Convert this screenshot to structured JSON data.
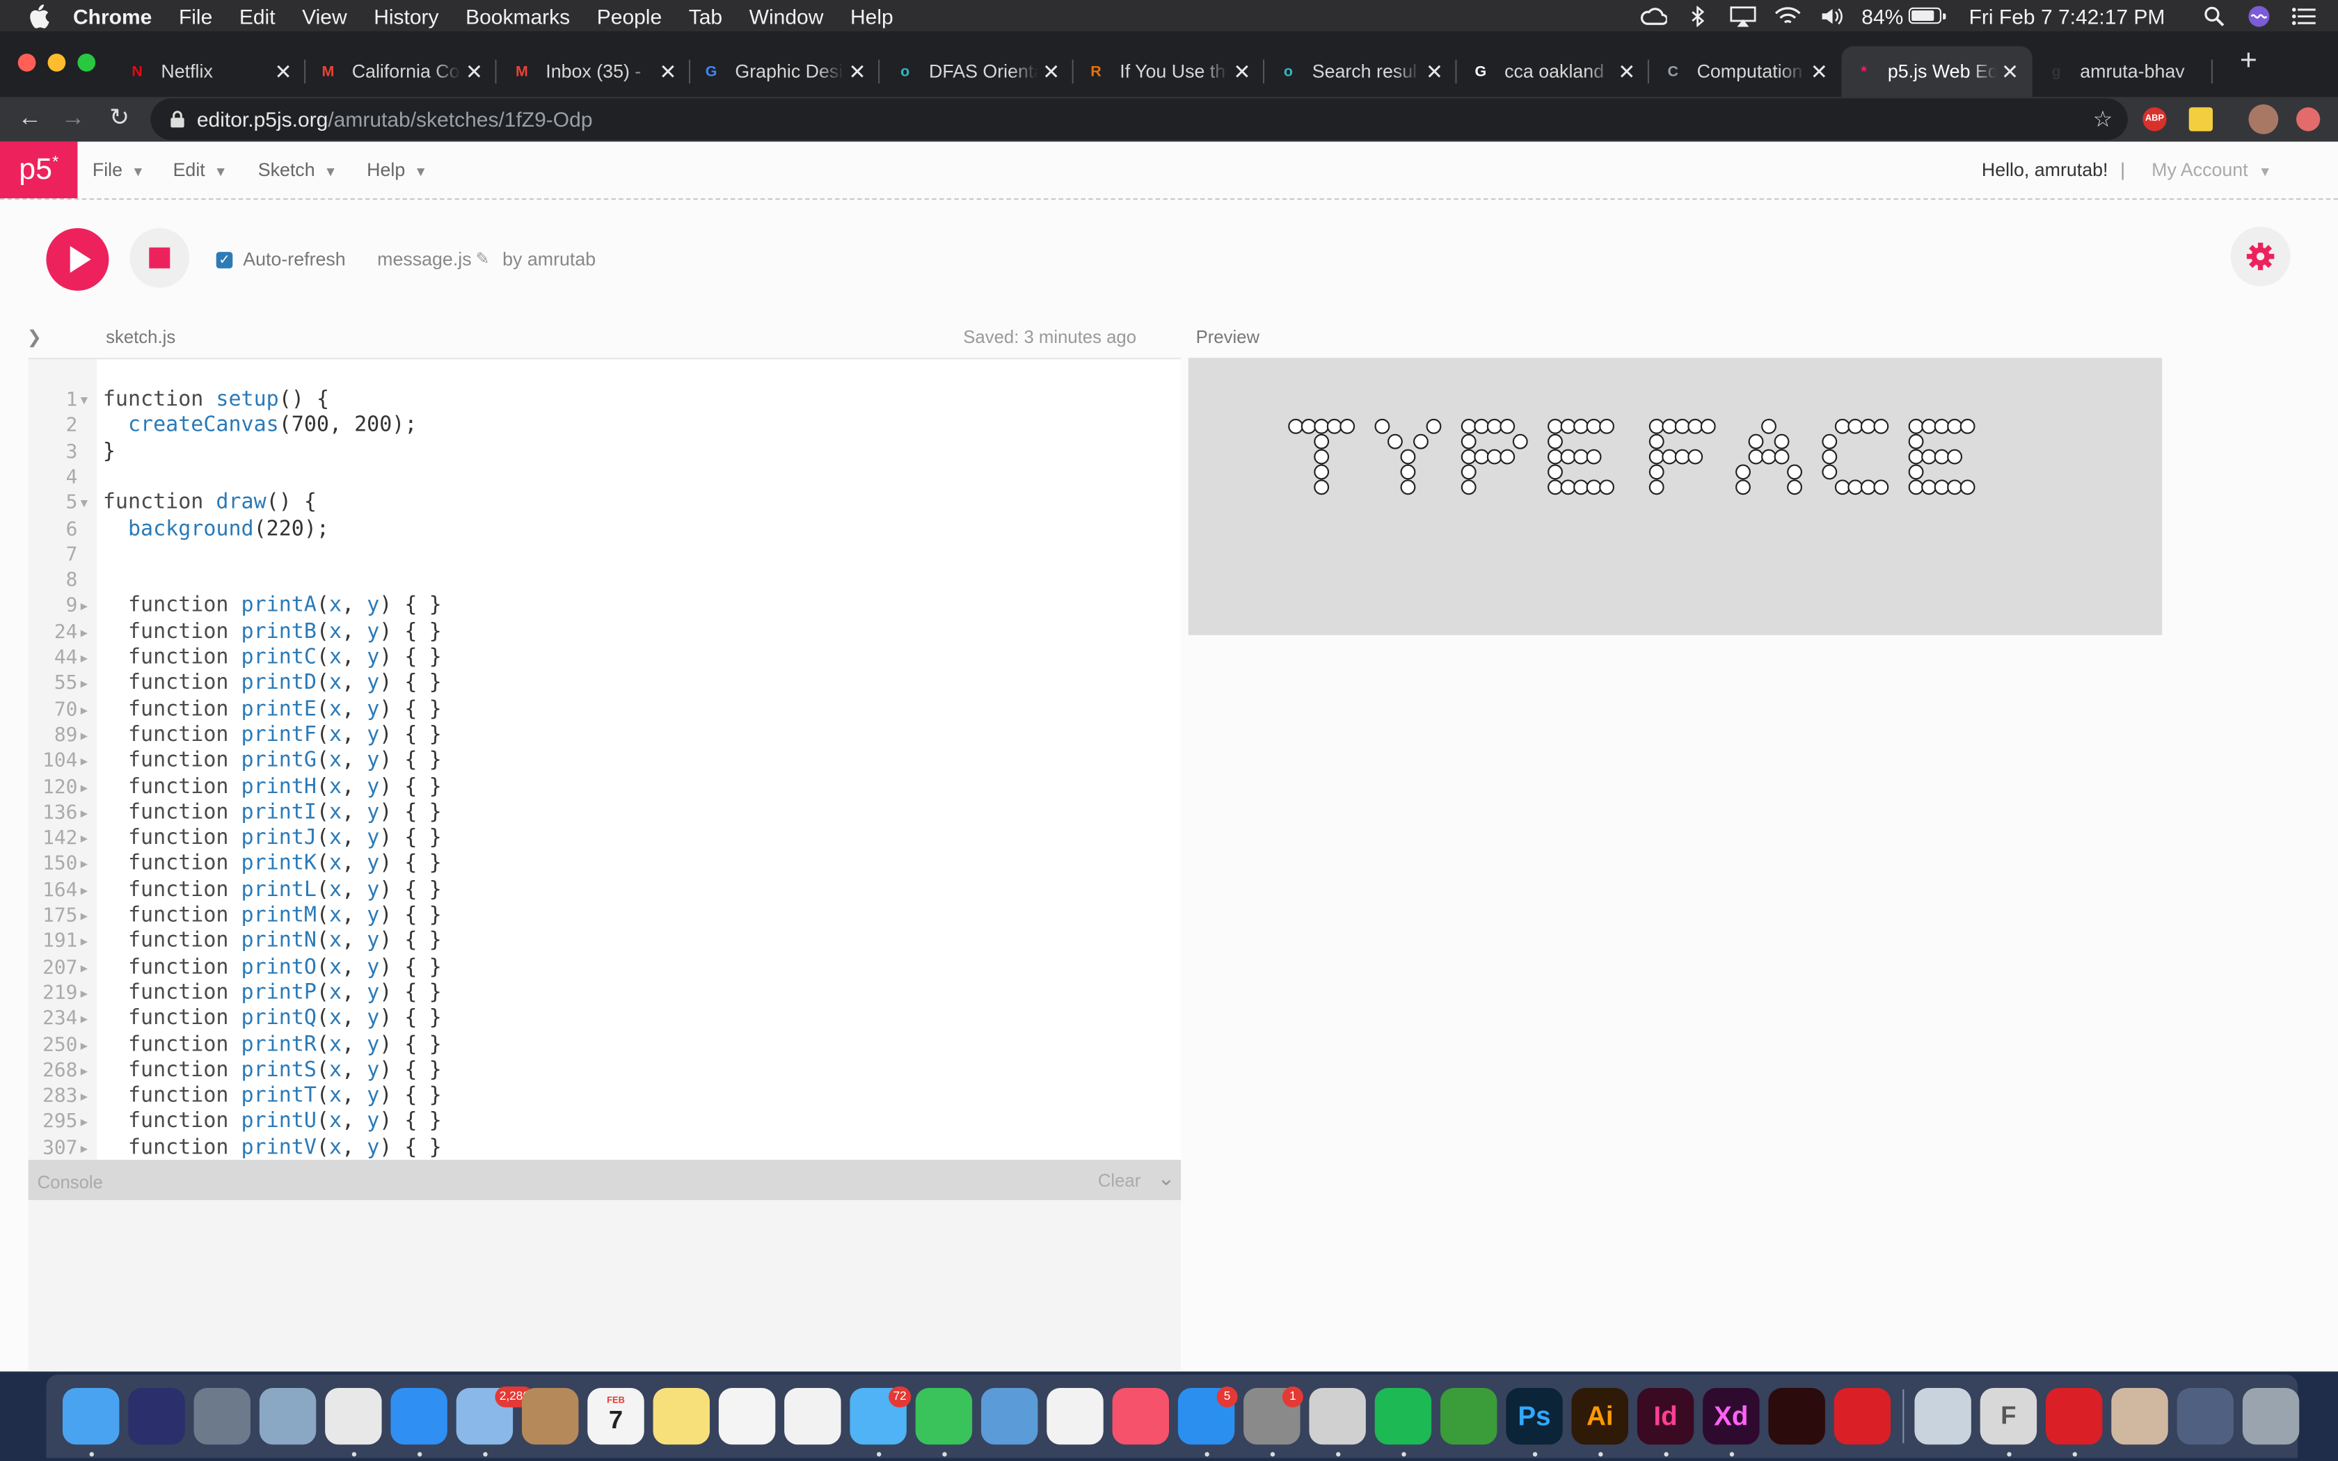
{
  "menubar": {
    "app": "Chrome",
    "items": [
      "File",
      "Edit",
      "View",
      "History",
      "Bookmarks",
      "People",
      "Tab",
      "Window",
      "Help"
    ],
    "battery_percent": "84%",
    "battery_level": 0.84,
    "clock": "Fri Feb 7  7:42:17 PM"
  },
  "tabs": [
    {
      "title": "Netflix",
      "favicon": "N",
      "color": "#e50914"
    },
    {
      "title": "California Co",
      "favicon": "M",
      "color": "#ea4335"
    },
    {
      "title": "Inbox (35) - ",
      "favicon": "M",
      "color": "#ea4335"
    },
    {
      "title": "Graphic Desi",
      "favicon": "G",
      "color": "#4285f4"
    },
    {
      "title": "DFAS Orienta",
      "favicon": "o",
      "color": "#30b8c4"
    },
    {
      "title": "If You Use th",
      "favicon": "R",
      "color": "#e8710a"
    },
    {
      "title": "Search resul",
      "favicon": "o",
      "color": "#30b8c4"
    },
    {
      "title": "cca oakland ",
      "favicon": "G",
      "color": "#ffffff"
    },
    {
      "title": "Computation",
      "favicon": "C",
      "color": "#9aa0a6"
    },
    {
      "title": "p5.js Web Ed",
      "favicon": "*",
      "color": "#ed225d"
    },
    {
      "title": "amruta-bhav",
      "favicon": "g",
      "color": "#333333"
    }
  ],
  "active_tab": 9,
  "address": {
    "host": "editor.p5js.org",
    "path": "/amrutab/sketches/1fZ9-Odp"
  },
  "extensions": {
    "abp": "ABP"
  },
  "p5": {
    "logo": "p5",
    "logo_sup": "*",
    "menus": [
      "File",
      "Edit",
      "Sketch",
      "Help"
    ],
    "greeting": "Hello, amrutab!",
    "divider": "|",
    "account": "My Account",
    "auto_refresh": "Auto-refresh",
    "sketch_name": "message.js",
    "author": "by amrutab",
    "file_tab": "sketch.js",
    "saved": "Saved: 3 minutes ago",
    "preview": "Preview",
    "console": "Console",
    "clear": "Clear"
  },
  "code_lines": [
    {
      "n": "1",
      "fold": "▼",
      "text": "function setup() {"
    },
    {
      "n": "2",
      "fold": "",
      "text": "  createCanvas(700, 200);"
    },
    {
      "n": "3",
      "fold": "",
      "text": "}"
    },
    {
      "n": "4",
      "fold": "",
      "text": ""
    },
    {
      "n": "5",
      "fold": "▼",
      "text": "function draw() {"
    },
    {
      "n": "6",
      "fold": "",
      "text": "  background(220);"
    },
    {
      "n": "7",
      "fold": "",
      "text": ""
    },
    {
      "n": "8",
      "fold": "",
      "text": ""
    },
    {
      "n": "9",
      "fold": "▶",
      "text": "  function printA(x, y) {"
    },
    {
      "n": "24",
      "fold": "▶",
      "text": "  function printB(x, y) {"
    },
    {
      "n": "44",
      "fold": "▶",
      "text": "  function printC(x, y) {"
    },
    {
      "n": "55",
      "fold": "▶",
      "text": "  function printD(x, y) {"
    },
    {
      "n": "70",
      "fold": "▶",
      "text": "  function printE(x, y) {"
    },
    {
      "n": "89",
      "fold": "▶",
      "text": "  function printF(x, y) {"
    },
    {
      "n": "104",
      "fold": "▶",
      "text": "  function printG(x, y) {"
    },
    {
      "n": "120",
      "fold": "▶",
      "text": "  function printH(x, y) {"
    },
    {
      "n": "136",
      "fold": "▶",
      "text": "  function printI(x, y) {"
    },
    {
      "n": "142",
      "fold": "▶",
      "text": "  function printJ(x, y) {"
    },
    {
      "n": "150",
      "fold": "▶",
      "text": "  function printK(x, y) {"
    },
    {
      "n": "164",
      "fold": "▶",
      "text": "  function printL(x, y) {"
    },
    {
      "n": "175",
      "fold": "▶",
      "text": "  function printM(x, y) {"
    },
    {
      "n": "191",
      "fold": "▶",
      "text": "  function printN(x, y) {"
    },
    {
      "n": "207",
      "fold": "▶",
      "text": "  function printO(x, y) {"
    },
    {
      "n": "219",
      "fold": "▶",
      "text": "  function printP(x, y) {"
    },
    {
      "n": "234",
      "fold": "▶",
      "text": "  function printQ(x, y) {"
    },
    {
      "n": "250",
      "fold": "▶",
      "text": "  function printR(x, y) {"
    },
    {
      "n": "268",
      "fold": "▶",
      "text": "  function printS(x, y) {"
    },
    {
      "n": "283",
      "fold": "▶",
      "text": "  function printT(x, y) {"
    },
    {
      "n": "295",
      "fold": "▶",
      "text": "  function printU(x, y) {"
    },
    {
      "n": "307",
      "fold": "▶",
      "text": "  function printV(x, y) {"
    }
  ],
  "folded_placeholder": "...",
  "preview_text": "TYPE FACE",
  "dock": [
    {
      "name": "finder-icon",
      "label": "",
      "bg": "#4aa3f0"
    },
    {
      "name": "siri-icon",
      "label": "",
      "bg": "#2b2f6b"
    },
    {
      "name": "launchpad-icon",
      "label": "",
      "bg": "#6c7a8c"
    },
    {
      "name": "preview-app-icon",
      "label": "",
      "bg": "#8aa7c4"
    },
    {
      "name": "chrome-icon",
      "label": "",
      "bg": "#e8e8e8"
    },
    {
      "name": "safari-icon",
      "label": "",
      "bg": "#2f8ff2"
    },
    {
      "name": "mail-icon",
      "label": "",
      "bg": "#8ab8e8",
      "badge": "2,286"
    },
    {
      "name": "contacts-icon",
      "label": "",
      "bg": "#b5895a"
    },
    {
      "name": "calendar-icon",
      "label": "7",
      "bg": "#f4f4f4",
      "sub": "FEB"
    },
    {
      "name": "notes-icon",
      "label": "",
      "bg": "#f7e07a"
    },
    {
      "name": "reminders-icon",
      "label": "",
      "bg": "#f4f4f4"
    },
    {
      "name": "photos-icon",
      "label": "",
      "bg": "#f2f2f2"
    },
    {
      "name": "messages-icon",
      "label": "",
      "bg": "#4fb3f5",
      "badge": "72"
    },
    {
      "name": "facetime-icon",
      "label": "",
      "bg": "#39c35a"
    },
    {
      "name": "keynote-icon",
      "label": "",
      "bg": "#5a9bd8"
    },
    {
      "name": "news-icon",
      "label": "",
      "bg": "#f2f2f2"
    },
    {
      "name": "music-icon",
      "label": "",
      "bg": "#f6526b"
    },
    {
      "name": "app-store-icon",
      "label": "",
      "bg": "#2b8ff0",
      "badge": "5"
    },
    {
      "name": "system-preferences-icon",
      "label": "",
      "bg": "#8a8a8a",
      "badge": "1"
    },
    {
      "name": "cyberduck-icon",
      "label": "",
      "bg": "#d0d0d0"
    },
    {
      "name": "spotify-icon",
      "label": "",
      "bg": "#1db954"
    },
    {
      "name": "sketchbook-icon",
      "label": "",
      "bg": "#3a9d3a"
    },
    {
      "name": "photoshop-icon",
      "label": "Ps",
      "bg": "#0b2438",
      "fg": "#31a8ff"
    },
    {
      "name": "illustrator-icon",
      "label": "Ai",
      "bg": "#2e1a06",
      "fg": "#ff9a00"
    },
    {
      "name": "indesign-icon",
      "label": "Id",
      "bg": "#3a0a22",
      "fg": "#ff3f94"
    },
    {
      "name": "xd-icon",
      "label": "Xd",
      "bg": "#2e0a2e",
      "fg": "#ff61f6"
    },
    {
      "name": "acrobat-icon",
      "label": "",
      "bg": "#2b0b0b"
    },
    {
      "name": "creative-cloud-icon",
      "label": "",
      "bg": "#da1f26"
    },
    {
      "name": "xcode-preview-icon",
      "label": "",
      "bg": "#c9d3dd"
    },
    {
      "name": "font-book-icon",
      "label": "F",
      "bg": "#d8d8d8",
      "fg": "#555555"
    },
    {
      "name": "creative-cloud-app-icon",
      "label": "",
      "bg": "#da1f26"
    },
    {
      "name": "photo-stack-icon",
      "label": "",
      "bg": "#d0b8a0"
    },
    {
      "name": "screenshots-stack-icon",
      "label": "",
      "bg": "#506080"
    },
    {
      "name": "trash-icon",
      "label": "",
      "bg": "#9aa4ae"
    }
  ],
  "colors": {
    "accent": "#ed225d",
    "link": "#2a7ab8"
  }
}
